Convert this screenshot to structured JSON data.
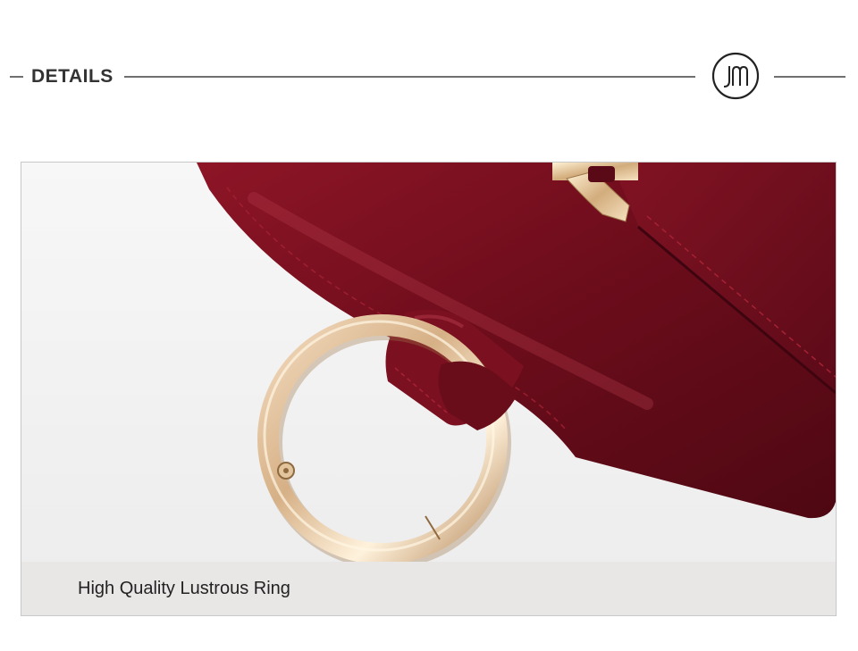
{
  "header": {
    "title": "DETAILS",
    "logo_icon": "jm-monogram-logo"
  },
  "photo": {
    "subject": "wallet-ring-photo",
    "caption": "High Quality Lustrous Ring"
  },
  "colors": {
    "leather": "#7a1020",
    "ring_gold": "#d9b890",
    "background": "#f2f2f2",
    "rule": "#707070"
  }
}
